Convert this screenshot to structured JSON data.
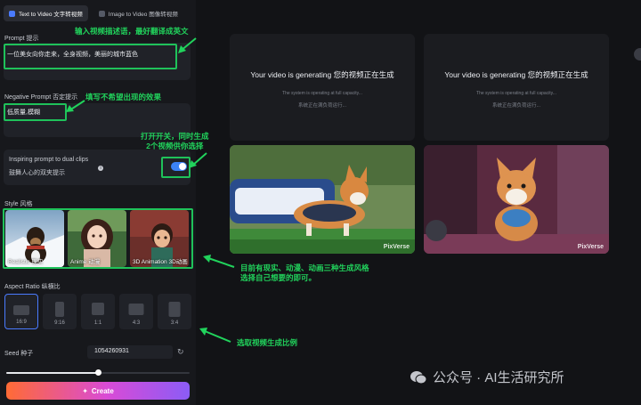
{
  "tabs": [
    {
      "label": "Text to Video 文字转视频",
      "active": true
    },
    {
      "label": "Image to Video 图像转视频",
      "active": false
    }
  ],
  "prompt": {
    "label": "Prompt 提示",
    "value": "一位美女向你走来，全身视频，美丽的城市蓝色"
  },
  "negative_prompt": {
    "label": "Negative Prompt 否定提示",
    "value": "低质量,模糊"
  },
  "dual_clips": {
    "label": "Inspiring prompt to dual clips",
    "sublabel": "鼓舞人心的双夹提示",
    "enabled": true
  },
  "style": {
    "label": "Style 风格",
    "options": [
      {
        "label": "Realistic 现实",
        "selected": true
      },
      {
        "label": "Anime 动漫",
        "selected": false
      },
      {
        "label": "3D Animation 3D动画",
        "selected": false
      }
    ]
  },
  "aspect_ratio": {
    "label": "Aspect Ratio 纵横比",
    "options": [
      {
        "label": "16:9",
        "selected": true
      },
      {
        "label": "9:16",
        "selected": false
      },
      {
        "label": "1:1",
        "selected": false
      },
      {
        "label": "4:3",
        "selected": false
      },
      {
        "label": "3:4",
        "selected": false
      }
    ]
  },
  "seed": {
    "label": "Seed 种子",
    "value": "1054260931"
  },
  "slider_value": 0.5,
  "create_label": "Create",
  "generating_cards": [
    {
      "title": "Your video is generating 您的视频正在生成",
      "sub_en": "The system is operating at full capacity...",
      "sub_zh": "系统正在满负荷运行..."
    },
    {
      "title": "Your video is generating 您的视频正在生成",
      "sub_en": "The system is operating at full capacity...",
      "sub_zh": "系统正在满负荷运行..."
    }
  ],
  "video_watermark": "PixVerse",
  "annotations": {
    "prompt": "输入视频描述语，最好翻译成英文",
    "negative": "填写不希望出现的效果",
    "toggle": "打开开关，同时生成\n2个视频供你选择",
    "style": "目前有现实、动漫、动画三种生成风格\n选择自己想要的即可。",
    "ratio": "选取视频生成比例"
  },
  "footer_brand": "公众号 · AI生活研究所",
  "colors": {
    "accent": "#3b82f6",
    "annotation": "#1fc25a",
    "background": "#121316",
    "panel": "#17181c"
  }
}
